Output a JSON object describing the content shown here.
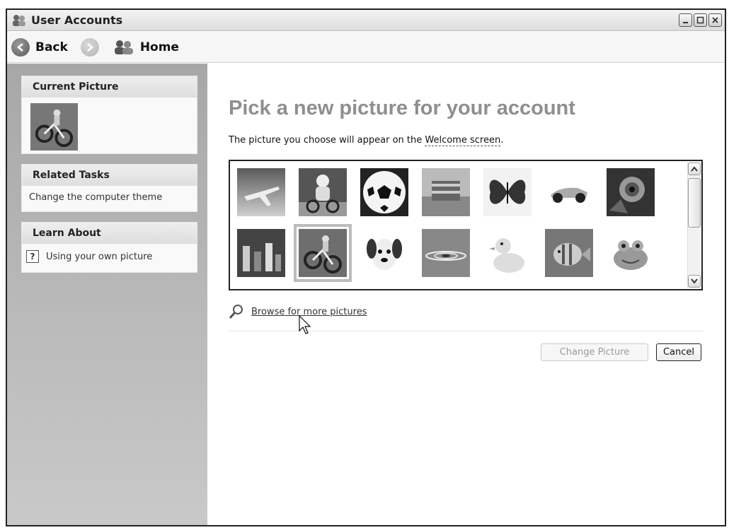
{
  "window": {
    "title": "User Accounts"
  },
  "nav": {
    "back_label": "Back",
    "home_label": "Home"
  },
  "sidebar": {
    "current_picture": {
      "title": "Current Picture"
    },
    "related_tasks": {
      "title": "Related Tasks",
      "items": [
        {
          "label": "Change the computer theme"
        }
      ]
    },
    "learn_about": {
      "title": "Learn About",
      "items": [
        {
          "label": "Using your own picture",
          "icon": "help-icon"
        }
      ]
    }
  },
  "main": {
    "heading": "Pick a new picture for your account",
    "subtext_prefix": "The picture you choose will appear on the ",
    "subtext_link": "Welcome screen",
    "subtext_suffix": ".",
    "pictures": [
      {
        "name": "airplane"
      },
      {
        "name": "astronaut"
      },
      {
        "name": "soccer-ball"
      },
      {
        "name": "beach-chairs"
      },
      {
        "name": "butterfly"
      },
      {
        "name": "race-car"
      },
      {
        "name": "cat-eye"
      },
      {
        "name": "chess"
      },
      {
        "name": "dirt-bike",
        "selected": true
      },
      {
        "name": "dog"
      },
      {
        "name": "water-drop"
      },
      {
        "name": "rubber-duck"
      },
      {
        "name": "fish"
      },
      {
        "name": "frog"
      }
    ],
    "browse_label": "Browse for more pictures",
    "change_button": "Change Picture",
    "cancel_button": "Cancel"
  },
  "colors": {
    "sidebar_bg": "#b5b5b5",
    "heading": "#8f8f8f",
    "selected_outline": "#bcbcbc"
  }
}
